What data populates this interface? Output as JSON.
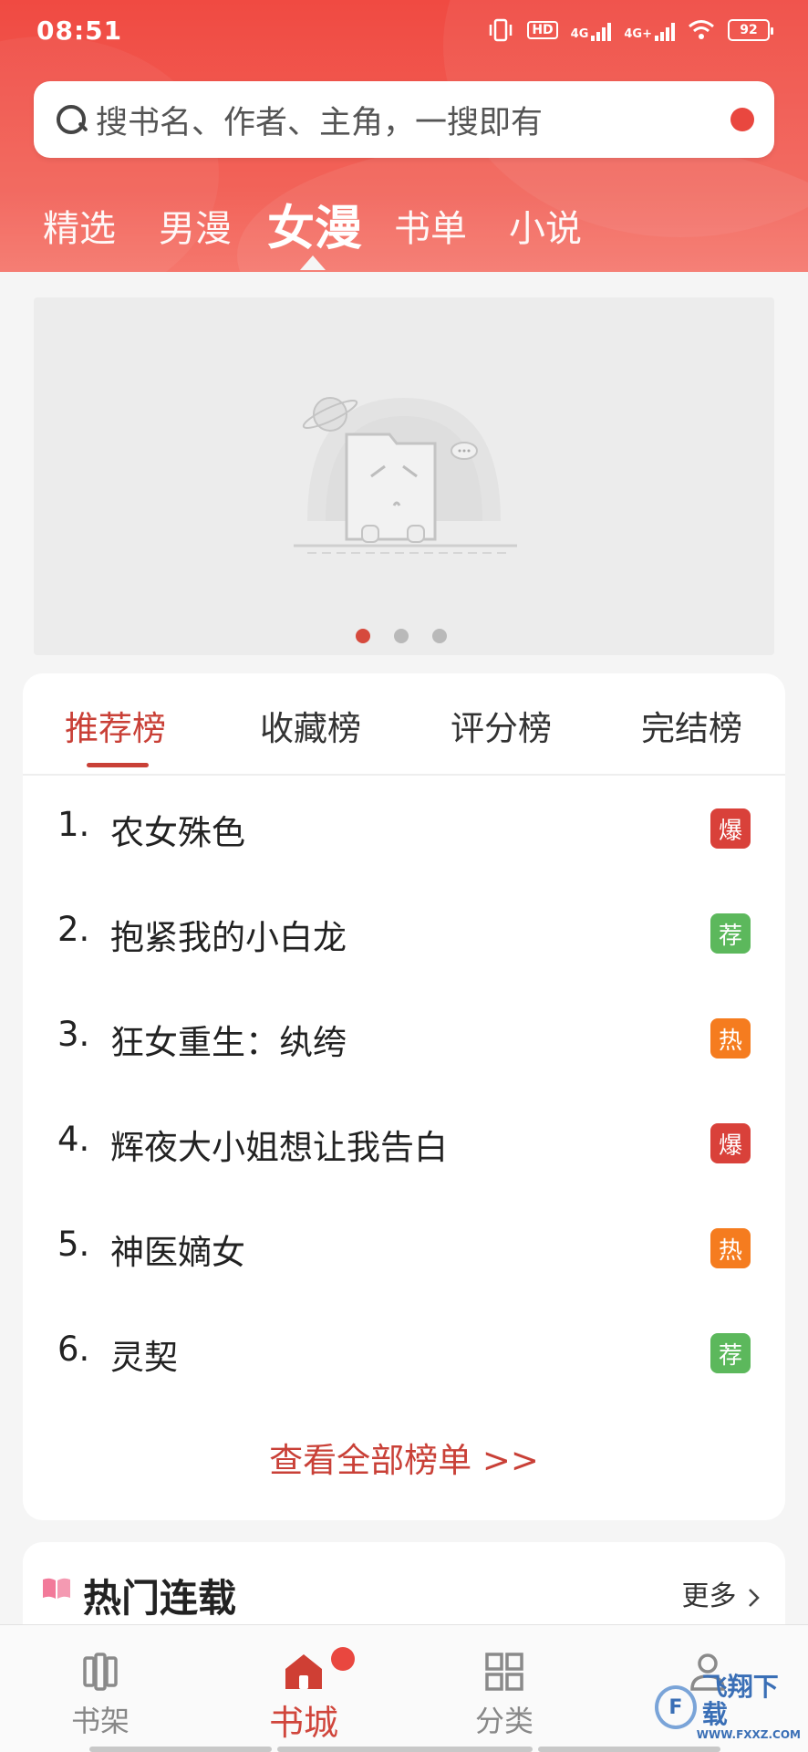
{
  "status_bar": {
    "time": "08:51",
    "network_1": "4G",
    "network_2": "4G+",
    "hd": "HD",
    "battery": "92"
  },
  "search": {
    "placeholder": "搜书名、作者、主角，一搜即有"
  },
  "top_tabs": [
    {
      "label": "精选",
      "active": false
    },
    {
      "label": "男漫",
      "active": false
    },
    {
      "label": "女漫",
      "active": true
    },
    {
      "label": "书单",
      "active": false
    },
    {
      "label": "小说",
      "active": false
    }
  ],
  "banner": {
    "pages": 3,
    "current_page": 1
  },
  "ranking": {
    "tabs": [
      {
        "label": "推荐榜",
        "active": true
      },
      {
        "label": "收藏榜",
        "active": false
      },
      {
        "label": "评分榜",
        "active": false
      },
      {
        "label": "完结榜",
        "active": false
      }
    ],
    "items": [
      {
        "num": "1.",
        "title": "农女殊色",
        "badge": "爆",
        "badge_color": "#d9413a"
      },
      {
        "num": "2.",
        "title": "抱紧我的小白龙",
        "badge": "荐",
        "badge_color": "#5cb85c"
      },
      {
        "num": "3.",
        "title": "狂女重生：纨绔",
        "badge": "热",
        "badge_color": "#f57c1f"
      },
      {
        "num": "4.",
        "title": "辉夜大小姐想让我告白",
        "badge": "爆",
        "badge_color": "#d9413a"
      },
      {
        "num": "5.",
        "title": "神医嫡女",
        "badge": "热",
        "badge_color": "#f57c1f"
      },
      {
        "num": "6.",
        "title": "灵契",
        "badge": "荐",
        "badge_color": "#5cb85c"
      }
    ],
    "view_all": "查看全部榜单 >>"
  },
  "hot_serial": {
    "title": "热门连载",
    "more": "更多"
  },
  "bottom_nav": [
    {
      "label": "书架",
      "icon": "bookshelf-icon",
      "active": false
    },
    {
      "label": "书城",
      "icon": "home-icon",
      "active": true
    },
    {
      "label": "分类",
      "icon": "category-icon",
      "active": false
    },
    {
      "label": "",
      "icon": "profile-icon",
      "active": false
    }
  ],
  "watermark": {
    "logo": "F",
    "text": "飞翔下载",
    "sub": "WWW.FXXZ.COM"
  },
  "colors": {
    "brand_red": "#f04a42",
    "accent_red": "#c94037"
  }
}
